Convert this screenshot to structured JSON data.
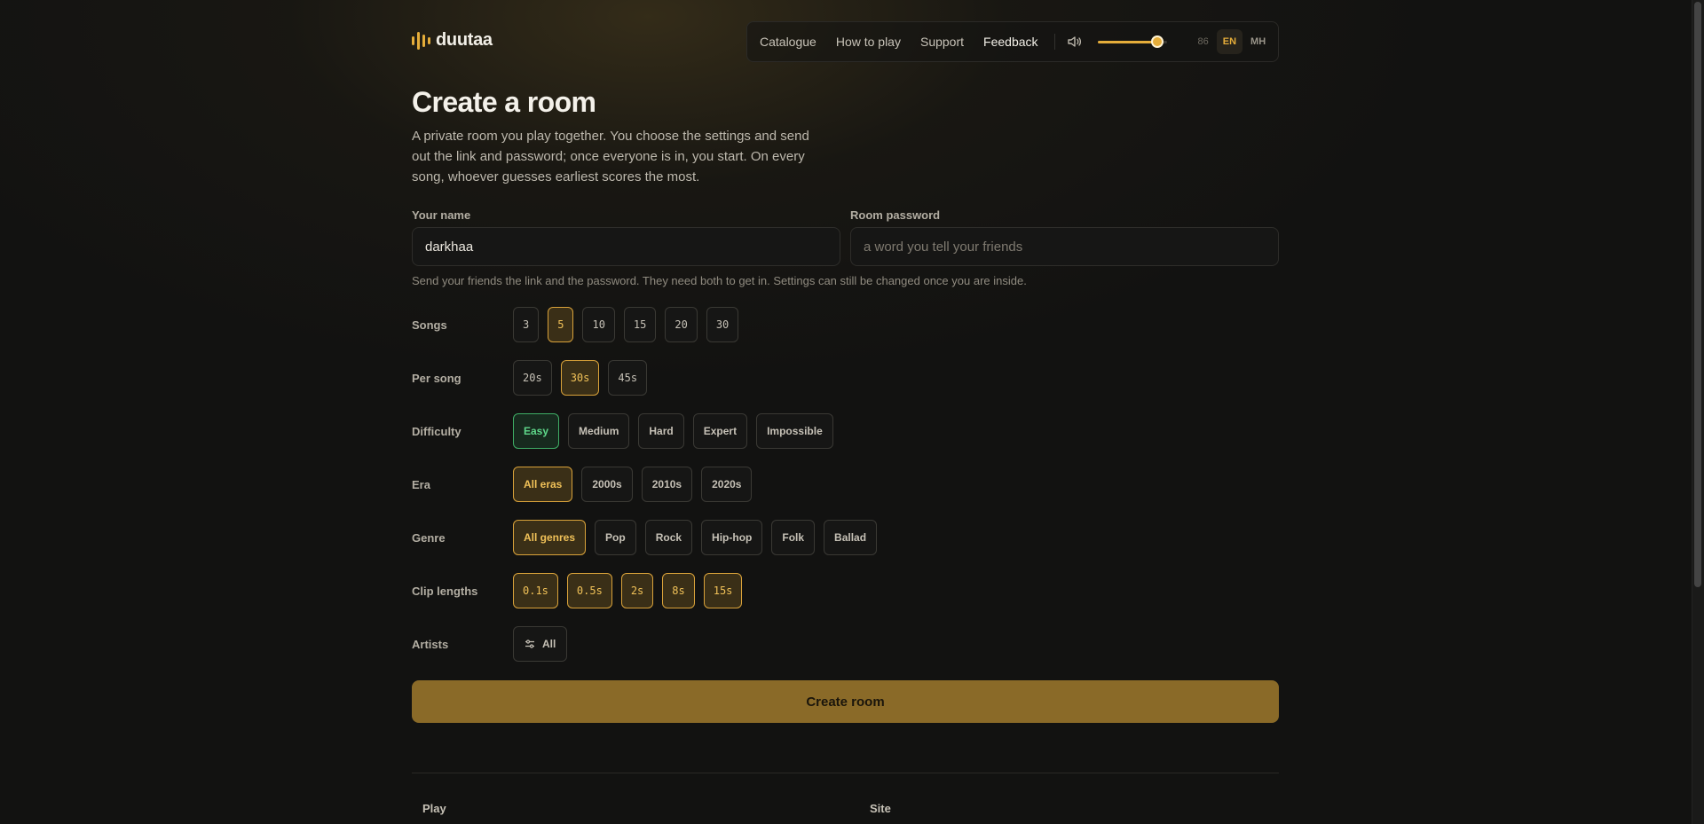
{
  "brand": {
    "name": "duutaa"
  },
  "nav": {
    "items": [
      {
        "label": "Catalogue"
      },
      {
        "label": "How to play"
      },
      {
        "label": "Support"
      },
      {
        "label": "Feedback"
      }
    ],
    "volume": {
      "level": 86,
      "label": "86"
    },
    "languages": [
      {
        "code": "EN"
      },
      {
        "code": "MH"
      }
    ],
    "selected_language": "EN"
  },
  "page": {
    "title": "Create a room",
    "intro": "A private room you play together. You choose the settings and send out the link and password; once everyone is in, you start. On every song, whoever guesses earliest scores the most."
  },
  "form": {
    "name_label": "Your name",
    "name_value": "darkhaa",
    "password_label": "Room password",
    "password_placeholder": "a word you tell your friends",
    "hint": "Send your friends the link and the password. They need both to get in. Settings can still be changed once you are inside."
  },
  "settings": {
    "songs": {
      "label": "Songs",
      "options": [
        "3",
        "5",
        "10",
        "15",
        "20",
        "30"
      ],
      "selected": "5"
    },
    "per_song": {
      "label": "Per song",
      "options": [
        "20s",
        "30s",
        "45s"
      ],
      "selected": "30s"
    },
    "difficulty": {
      "label": "Difficulty",
      "options": [
        "Easy",
        "Medium",
        "Hard",
        "Expert",
        "Impossible"
      ],
      "selected": "Easy"
    },
    "era": {
      "label": "Era",
      "options": [
        "All eras",
        "2000s",
        "2010s",
        "2020s"
      ],
      "selected": "All eras"
    },
    "genre": {
      "label": "Genre",
      "options": [
        "All genres",
        "Pop",
        "Rock",
        "Hip-hop",
        "Folk",
        "Ballad"
      ],
      "selected": "All genres"
    },
    "clip_lengths": {
      "label": "Clip lengths",
      "options": [
        "0.1s",
        "0.5s",
        "2s",
        "8s",
        "15s"
      ],
      "selected": [
        "0.1s",
        "0.5s",
        "2s",
        "8s",
        "15s"
      ]
    },
    "artists": {
      "label": "Artists",
      "button_label": "All"
    }
  },
  "actions": {
    "create_label": "Create room"
  },
  "footer": {
    "play_heading": "Play",
    "site_heading": "Site"
  },
  "colors": {
    "accent": "#e5ad3a",
    "button": "#8a6a28",
    "easy": "#5fd78a"
  }
}
